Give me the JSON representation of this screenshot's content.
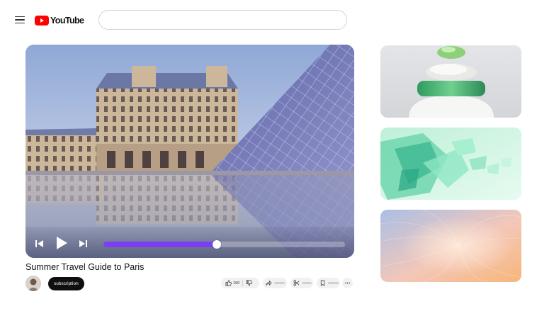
{
  "header": {
    "menu_icon": "hamburger-menu-icon",
    "logo_text": "YouTube",
    "logo_color": "#ff0000",
    "search": {
      "value": "",
      "placeholder": ""
    }
  },
  "player": {
    "progress": 0.47,
    "progress_color": "#7b3ff2",
    "controls": [
      "previous-icon",
      "play-icon",
      "next-icon"
    ]
  },
  "video": {
    "title": "Summer Travel Guide to Paris",
    "channel": {
      "subscribe_label": "subscription"
    },
    "actions": {
      "like_count": "190"
    }
  },
  "recommendations": [
    {
      "thumbnail": "stacked-stones"
    },
    {
      "thumbnail": "green-glass-shards"
    },
    {
      "thumbnail": "pastel-gradient-swirl"
    }
  ]
}
